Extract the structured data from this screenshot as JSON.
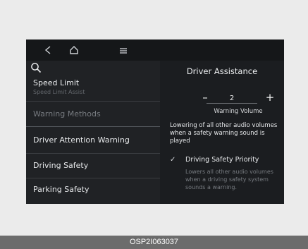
{
  "topbar": {
    "icons": [
      "back-icon",
      "home-icon",
      "menu-icon"
    ]
  },
  "left_menu": {
    "items": [
      {
        "label": "Speed Limit",
        "sublabel": "Speed Limit Assist"
      },
      {
        "label": "Warning Methods"
      },
      {
        "label": "Driver Attention Warning"
      },
      {
        "label": "Driving Safety"
      },
      {
        "label": "Parking Safety"
      }
    ]
  },
  "right_panel": {
    "title": "Driver Assistance",
    "warning_volume": {
      "minus_label": "–",
      "plus_label": "+",
      "value": "2",
      "label": "Warning Volume"
    },
    "description": "Lowering of all other audio volumes when a safety warning sound is played",
    "driving_safety_priority": {
      "label": "Driving Safety Priority",
      "checked": true,
      "description": "Lowers all other audio volumes when a driving safety system sounds a warning."
    }
  },
  "footer": {
    "code": "OSP2I063037"
  },
  "colors": {
    "screen_bg": "#1a1c1f",
    "left_panel_bg": "#202225",
    "right_panel_bg": "#1b1d20",
    "page_bg": "#ebebeb",
    "footer_bg": "#6c6c6c",
    "dim_text": "#777b80"
  }
}
